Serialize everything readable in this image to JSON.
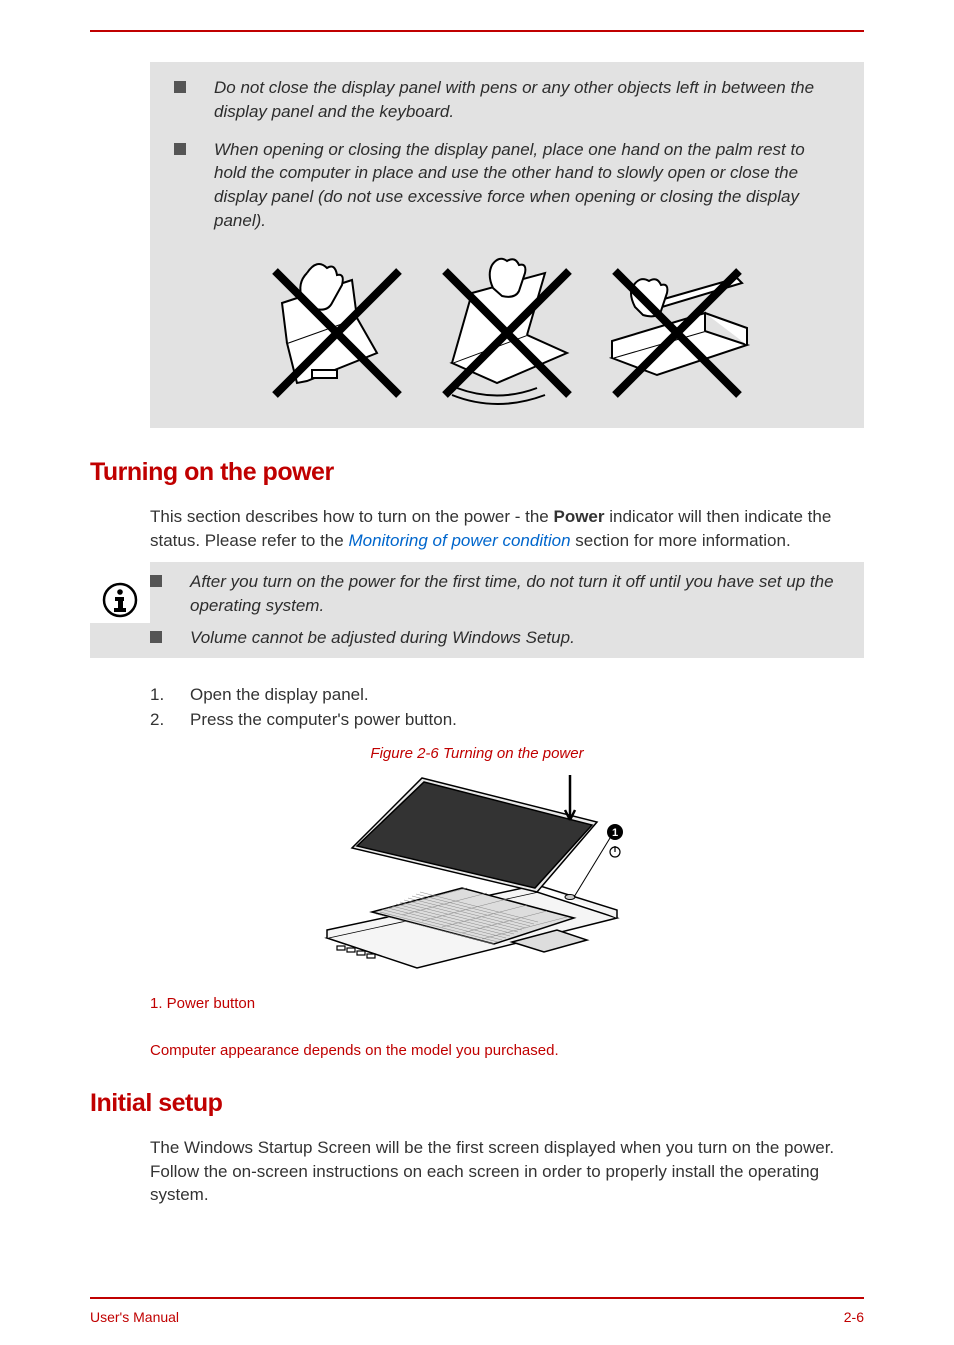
{
  "warnings": {
    "item1": "Do not close the display panel with pens or any other objects left in between the display panel and the keyboard.",
    "item2": "When opening or closing the display panel, place one hand on the palm rest to hold the computer in place and use the other hand to slowly open or close the display panel (do not use excessive force when opening or closing the display panel)."
  },
  "section1": {
    "heading": "Turning on the power",
    "intro_1": "This section describes how to turn on the power - the ",
    "intro_bold": "Power",
    "intro_2": " indicator will then indicate the status. Please refer to the ",
    "intro_link": "Monitoring of power condition",
    "intro_3": " section for more information."
  },
  "info_notes": {
    "n1": "After you turn on the power for the first time, do not turn it off until you have set up the operating system.",
    "n2": "Volume cannot be adjusted during Windows Setup."
  },
  "steps": {
    "s1_num": "1.",
    "s1": "Open the display panel.",
    "s2_num": "2.",
    "s2": "Press the computer's power button."
  },
  "figure": {
    "caption": "Figure 2-6 Turning on the power",
    "label": "1. Power button",
    "note": "Computer appearance depends on the model you purchased.",
    "callout_num": "1"
  },
  "section2": {
    "heading": "Initial setup",
    "body": "The Windows Startup Screen will be the first screen displayed when you turn on the power. Follow the on-screen instructions on each screen in order to properly install the operating system."
  },
  "footer": {
    "left": "User's Manual",
    "right": "2-6"
  }
}
